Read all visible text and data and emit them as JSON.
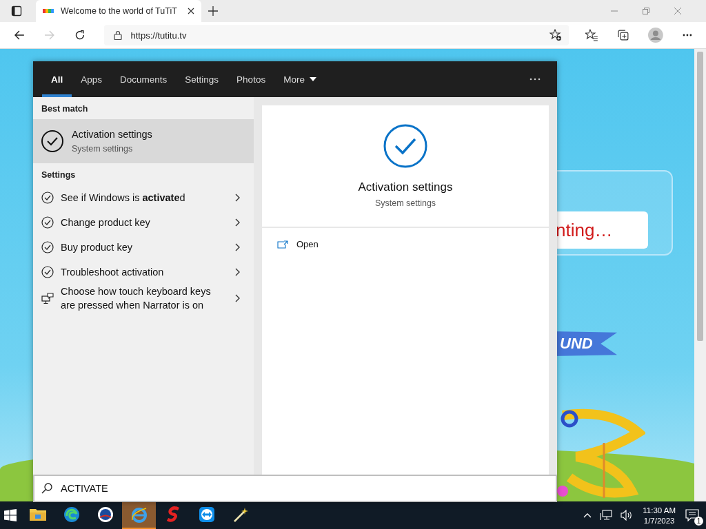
{
  "browser": {
    "tab_title": "Welcome to the world of TuTiT",
    "url": "https://tutitu.tv"
  },
  "website": {
    "notice": "nting…",
    "banner": "UND"
  },
  "search": {
    "tabs": [
      {
        "label": "All",
        "selected": true
      },
      {
        "label": "Apps",
        "selected": false
      },
      {
        "label": "Documents",
        "selected": false
      },
      {
        "label": "Settings",
        "selected": false
      },
      {
        "label": "Photos",
        "selected": false
      },
      {
        "label": "More",
        "selected": false
      }
    ],
    "best_match_heading": "Best match",
    "best_match": {
      "title": "Activation settings",
      "subtitle": "System settings",
      "selected": true
    },
    "settings_heading": "Settings",
    "results": [
      {
        "label": "See if Windows is **activate**d",
        "kind": "check"
      },
      {
        "label": "Change product key",
        "kind": "check"
      },
      {
        "label": "Buy product key",
        "kind": "check"
      },
      {
        "label": "Troubleshoot activation",
        "kind": "check"
      },
      {
        "label": "Choose how touch keyboard keys are pressed when Narrator is on",
        "kind": "narrator"
      }
    ],
    "detail": {
      "title": "Activation settings",
      "subtitle": "System settings"
    },
    "actions": [
      {
        "label": "Open"
      }
    ],
    "query": "ACTIVATE"
  },
  "taskbar": {
    "apps": [
      {
        "kind": "folder",
        "active": false
      },
      {
        "kind": "edge",
        "active": false
      },
      {
        "kind": "ring",
        "active": false
      },
      {
        "kind": "ie",
        "active": true
      },
      {
        "kind": "s",
        "active": false
      },
      {
        "kind": "remote",
        "active": false
      },
      {
        "kind": "wand",
        "active": false
      }
    ],
    "time": "11:30 AM",
    "date": "1/7/2023",
    "notifications": "1"
  }
}
